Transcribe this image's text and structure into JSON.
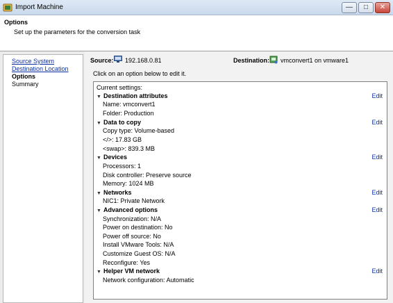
{
  "window": {
    "title": "Import Machine",
    "buttons": {
      "minimize": "—",
      "maximize": "□",
      "close": "✕"
    }
  },
  "header": {
    "title": "Options",
    "subtitle": "Set up the parameters for the conversion task"
  },
  "nav": {
    "items": [
      {
        "label": "Source System",
        "link": true
      },
      {
        "label": "Destination Location",
        "link": true
      },
      {
        "label": "Options",
        "link": false,
        "current": true
      },
      {
        "label": "Summary",
        "link": false
      }
    ]
  },
  "source": {
    "label": "Source:",
    "value": "192.168.0.81",
    "icon": "computer-icon"
  },
  "destination": {
    "label": "Destination:",
    "value": "vmconvert1 on vmware1",
    "icon": "vm-icon"
  },
  "hint": "Click on an option below to edit it.",
  "settings": {
    "header": "Current settings:",
    "edit_label": "Edit",
    "sections": [
      {
        "title": "Destination attributes",
        "items": [
          "Name: vmconvert1",
          "Folder: Production"
        ]
      },
      {
        "title": "Data to copy",
        "items": [
          "Copy type: Volume-based",
          "</>: 17.83 GB",
          "<swap>: 839.3 MB"
        ]
      },
      {
        "title": "Devices",
        "items": [
          "Processors: 1",
          "Disk controller: Preserve source",
          "Memory: 1024 MB"
        ]
      },
      {
        "title": "Networks",
        "items": [
          "NIC1: Private Network"
        ]
      },
      {
        "title": "Advanced options",
        "items": [
          "Synchronization: N/A",
          "Power on destination: No",
          "Power off source: No",
          "Install VMware Tools: N/A",
          "Customize Guest OS: N/A",
          "Reconfigure: Yes"
        ]
      },
      {
        "title": "Helper VM network",
        "items": [
          "Network configuration: Automatic"
        ]
      }
    ]
  }
}
